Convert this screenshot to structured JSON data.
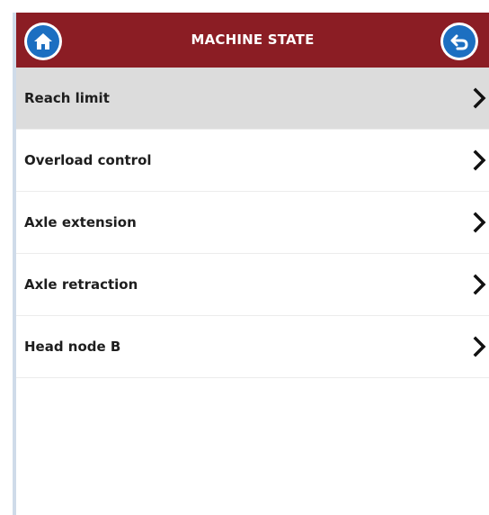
{
  "header": {
    "title": "MACHINE STATE",
    "home_icon": "home-icon",
    "back_icon": "return-arrow-icon"
  },
  "menu": {
    "items": [
      {
        "label": "Reach limit",
        "selected": true
      },
      {
        "label": "Overload control",
        "selected": false
      },
      {
        "label": "Axle extension",
        "selected": false
      },
      {
        "label": "Axle retraction",
        "selected": false
      },
      {
        "label": "Head node B",
        "selected": false
      }
    ],
    "chevron_icon": "chevron-right-icon"
  },
  "colors": {
    "header_bg": "#8b1d24",
    "icon_blue": "#1c6fc1",
    "selected_row_bg": "#dcdcdc"
  }
}
